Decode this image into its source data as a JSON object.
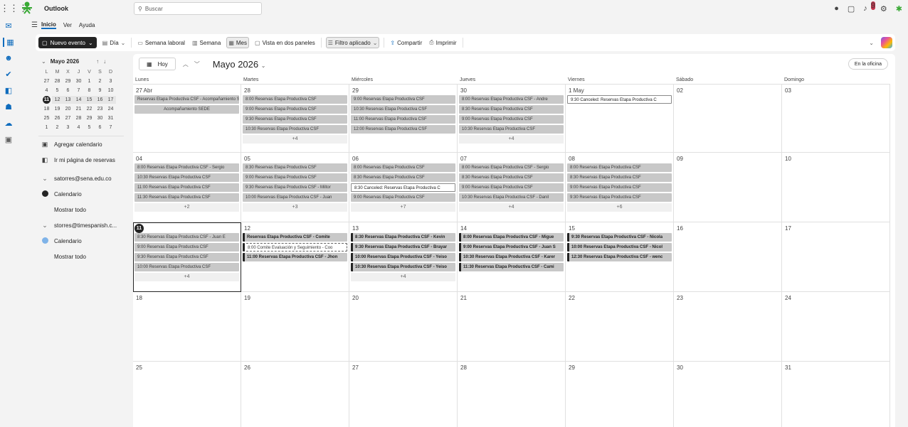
{
  "app": {
    "name": "Outlook"
  },
  "search": {
    "placeholder": "Buscar"
  },
  "menu": {
    "items": [
      "Inicio",
      "Ver",
      "Ayuda"
    ]
  },
  "ribbon": {
    "new_event": "Nuevo evento",
    "day": "Día",
    "work_week": "Semana laboral",
    "week": "Semana",
    "month": "Mes",
    "split_view": "Vista en dos paneles",
    "filter": "Filtro aplicado",
    "share": "Compartir",
    "print": "Imprimir"
  },
  "minical": {
    "title": "Mayo 2026",
    "weekday_headers": [
      "L",
      "M",
      "X",
      "J",
      "V",
      "S",
      "D"
    ],
    "weeks": [
      [
        "27",
        "28",
        "29",
        "30",
        "1",
        "2",
        "3"
      ],
      [
        "4",
        "5",
        "6",
        "7",
        "8",
        "9",
        "10"
      ],
      [
        "11",
        "12",
        "13",
        "14",
        "15",
        "16",
        "17"
      ],
      [
        "18",
        "19",
        "20",
        "21",
        "22",
        "23",
        "24"
      ],
      [
        "25",
        "26",
        "27",
        "28",
        "29",
        "30",
        "31"
      ],
      [
        "1",
        "2",
        "3",
        "4",
        "5",
        "6",
        "7"
      ]
    ]
  },
  "leftpane": {
    "add_calendar": "Agregar calendario",
    "booking_page": "Ir mi página de reservas",
    "account1": "satorres@sena.edu.co",
    "calendar1": "Calendario",
    "show_all1": "Mostrar todo",
    "account2": "storres@timespanish.c...",
    "calendar2": "Calendario",
    "show_all2": "Mostrar todo"
  },
  "calendar": {
    "today_label": "Hoy",
    "month_title": "Mayo 2026",
    "office_label": "En la oficina",
    "weekdays": [
      "Lunes",
      "Martes",
      "Miércoles",
      "Jueves",
      "Viernes",
      "Sábado",
      "Domingo"
    ],
    "weeks": [
      {
        "days": [
          {
            "label": "27 Abr",
            "events": [
              {
                "text": "Reservas Etapa Productiva CSF - Acompañamiento SEDE",
                "style": "gray"
              },
              {
                "text": "Acompañamiento SEDE",
                "style": "center"
              }
            ],
            "more": ""
          },
          {
            "label": "28",
            "events": [
              {
                "text": "8:00 Reservas Etapa Productiva CSF",
                "style": "gray"
              },
              {
                "text": "9:00 Reservas Etapa Productiva CSF",
                "style": "gray"
              },
              {
                "text": "9:30 Reservas Etapa Productiva CSF",
                "style": "gray"
              },
              {
                "text": "10:30 Reservas Etapa Productiva CSF",
                "style": "gray"
              }
            ],
            "more": "+4"
          },
          {
            "label": "29",
            "events": [
              {
                "text": "9:00 Reservas Etapa Productiva CSF",
                "style": "gray"
              },
              {
                "text": "10:30 Reservas Etapa Productiva CSF",
                "style": "gray"
              },
              {
                "text": "11:00 Reservas Etapa Productiva CSF",
                "style": "gray"
              },
              {
                "text": "12:00 Reservas Etapa Productiva CSF",
                "style": "gray"
              }
            ],
            "more": ""
          },
          {
            "label": "30",
            "events": [
              {
                "text": "8:00 Reservas Etapa Productiva CSF - Andre",
                "style": "gray"
              },
              {
                "text": "8:30 Reservas Etapa Productiva CSF",
                "style": "gray"
              },
              {
                "text": "9:00 Reservas Etapa Productiva CSF",
                "style": "gray"
              },
              {
                "text": "10:30 Reservas Etapa Productiva CSF",
                "style": "gray"
              }
            ],
            "more": "+4"
          },
          {
            "label": "1 May",
            "events": [
              {
                "text": "9:30 Canceled: Reservas Etapa Productiva C",
                "style": "canceled"
              }
            ],
            "more": ""
          },
          {
            "label": "02",
            "events": [],
            "more": ""
          },
          {
            "label": "03",
            "events": [],
            "more": ""
          }
        ]
      },
      {
        "days": [
          {
            "label": "04",
            "events": [
              {
                "text": "8:00 Reservas Etapa Productiva CSF - Sergio",
                "style": "gray"
              },
              {
                "text": "10:30 Reservas Etapa Productiva CSF",
                "style": "gray"
              },
              {
                "text": "11:00 Reservas Etapa Productiva CSF",
                "style": "gray"
              },
              {
                "text": "11:30 Reservas Etapa Productiva CSF",
                "style": "gray"
              }
            ],
            "more": "+2"
          },
          {
            "label": "05",
            "events": [
              {
                "text": "8:30 Reservas Etapa Productiva CSF",
                "style": "gray"
              },
              {
                "text": "9:00 Reservas Etapa Productiva CSF",
                "style": "gray"
              },
              {
                "text": "9:30 Reservas Etapa Productiva CSF - Miltor",
                "style": "gray"
              },
              {
                "text": "10:00 Reservas Etapa Productiva CSF - Juan",
                "style": "gray"
              }
            ],
            "more": "+3"
          },
          {
            "label": "06",
            "events": [
              {
                "text": "8:00 Reservas Etapa Productiva CSF",
                "style": "gray"
              },
              {
                "text": "8:30 Reservas Etapa Productiva CSF",
                "style": "gray"
              },
              {
                "text": "8:30 Canceled: Reservas Etapa Productiva C",
                "style": "canceled"
              },
              {
                "text": "9:00 Reservas Etapa Productiva CSF",
                "style": "gray"
              }
            ],
            "more": "+7"
          },
          {
            "label": "07",
            "events": [
              {
                "text": "8:00 Reservas Etapa Productiva CSF - Sergio",
                "style": "gray"
              },
              {
                "text": "8:30 Reservas Etapa Productiva CSF",
                "style": "gray"
              },
              {
                "text": "9:00 Reservas Etapa Productiva CSF",
                "style": "gray"
              },
              {
                "text": "10:30 Reservas Etapa Productiva CSF - Danil",
                "style": "gray"
              }
            ],
            "more": "+4"
          },
          {
            "label": "08",
            "events": [
              {
                "text": "8:00 Reservas Etapa Productiva CSF",
                "style": "gray"
              },
              {
                "text": "8:30 Reservas Etapa Productiva CSF",
                "style": "gray"
              },
              {
                "text": "9:00 Reservas Etapa Productiva CSF",
                "style": "gray"
              },
              {
                "text": "9:30 Reservas Etapa Productiva CSF",
                "style": "gray"
              }
            ],
            "more": "+6"
          },
          {
            "label": "09",
            "events": [],
            "more": ""
          },
          {
            "label": "10",
            "events": [],
            "more": ""
          }
        ]
      },
      {
        "days": [
          {
            "label": "11",
            "today": true,
            "selected": true,
            "events": [
              {
                "text": "8:30 Reservas Etapa Productiva CSF - Juan E",
                "style": "gray"
              },
              {
                "text": "9:00 Reservas Etapa Productiva CSF",
                "style": "gray"
              },
              {
                "text": "9:30 Reservas Etapa Productiva CSF",
                "style": "gray"
              },
              {
                "text": "10:00 Reservas Etapa Productiva CSF",
                "style": "gray"
              }
            ],
            "more": "+4"
          },
          {
            "label": "12",
            "events": [
              {
                "text": "Reservas Etapa Productiva CSF - Comite",
                "style": "dark"
              },
              {
                "text": "8:00 Comite Evaluación y Seguimiento - Coo",
                "style": "dashed"
              },
              {
                "text": "11:00 Reservas Etapa Productiva CSF - Jhon",
                "style": "dark"
              }
            ],
            "more": ""
          },
          {
            "label": "13",
            "events": [
              {
                "text": "8:30 Reservas Etapa Productiva CSF - Kevin",
                "style": "dark"
              },
              {
                "text": "9:30 Reservas Etapa Productiva CSF - Brayar",
                "style": "dark"
              },
              {
                "text": "10:00 Reservas Etapa Productiva CSF - Yeiso",
                "style": "dark"
              },
              {
                "text": "10:30 Reservas Etapa Productiva CSF - Yeiso",
                "style": "dark"
              }
            ],
            "more": "+4"
          },
          {
            "label": "14",
            "events": [
              {
                "text": "8:00 Reservas Etapa Productiva CSF - Migue",
                "style": "dark"
              },
              {
                "text": "9:00 Reservas Etapa Productiva CSF - Juan S",
                "style": "dark"
              },
              {
                "text": "10:30 Reservas Etapa Productiva CSF - Karer",
                "style": "dark"
              },
              {
                "text": "11:30 Reservas Etapa Productiva CSF - Cami",
                "style": "dark"
              }
            ],
            "more": ""
          },
          {
            "label": "15",
            "events": [
              {
                "text": "9:30 Reservas Etapa Productiva CSF - Nicola",
                "style": "dark"
              },
              {
                "text": "10:00 Reservas Etapa Productiva CSF - Nicol",
                "style": "dark"
              },
              {
                "text": "12:30 Reservas Etapa Productiva CSF - wenc",
                "style": "dark"
              }
            ],
            "more": ""
          },
          {
            "label": "16",
            "events": [],
            "more": ""
          },
          {
            "label": "17",
            "events": [],
            "more": ""
          }
        ]
      },
      {
        "days": [
          {
            "label": "18",
            "events": [],
            "more": ""
          },
          {
            "label": "19",
            "events": [],
            "more": ""
          },
          {
            "label": "20",
            "events": [],
            "more": ""
          },
          {
            "label": "21",
            "events": [],
            "more": ""
          },
          {
            "label": "22",
            "events": [],
            "more": ""
          },
          {
            "label": "23",
            "events": [],
            "more": ""
          },
          {
            "label": "24",
            "events": [],
            "more": ""
          }
        ]
      },
      {
        "days": [
          {
            "label": "25",
            "events": [],
            "more": ""
          },
          {
            "label": "26",
            "events": [],
            "more": ""
          },
          {
            "label": "27",
            "events": [],
            "more": ""
          },
          {
            "label": "28",
            "events": [],
            "more": ""
          },
          {
            "label": "29",
            "events": [],
            "more": ""
          },
          {
            "label": "30",
            "events": [],
            "more": ""
          },
          {
            "label": "31",
            "events": [],
            "more": ""
          }
        ]
      }
    ]
  },
  "notifications": {
    "count": "9"
  },
  "colors": {
    "accent": "#0f6cbd",
    "event_gray": "#c8c8c8",
    "event_dark_border": "#242424",
    "calendar2_dot": "#7fb3e8"
  }
}
